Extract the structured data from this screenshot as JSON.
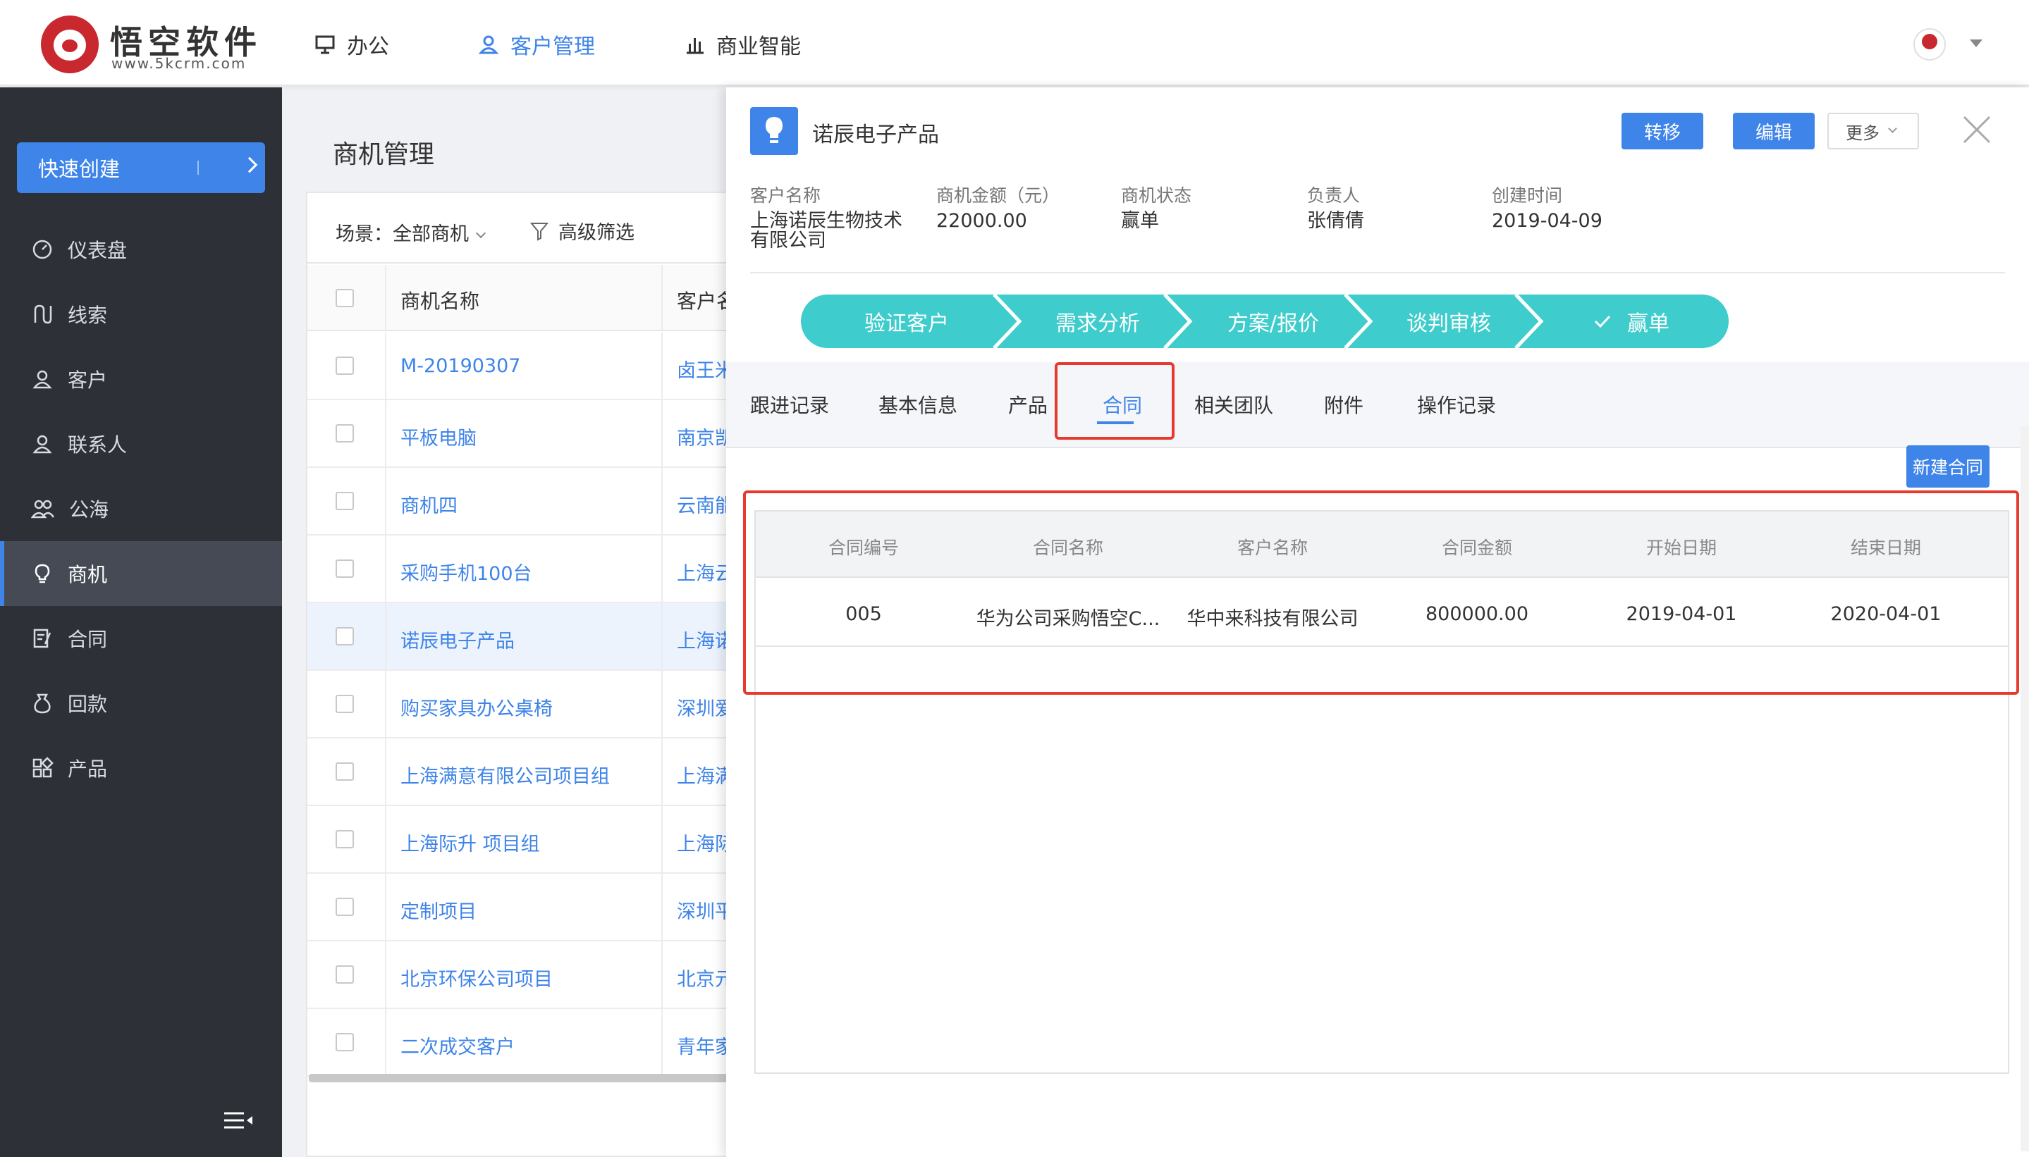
{
  "brand": {
    "name": "悟空软件",
    "url": "www.5kcrm.com"
  },
  "nav": [
    {
      "label": "办公",
      "icon": "monitor-icon",
      "active": false
    },
    {
      "label": "客户管理",
      "icon": "user-icon",
      "active": true
    },
    {
      "label": "商业智能",
      "icon": "bar-chart-icon",
      "active": false
    }
  ],
  "sidebar": {
    "quick_create": "快速创建",
    "items": [
      {
        "label": "仪表盘",
        "icon": "dashboard-icon"
      },
      {
        "label": "线索",
        "icon": "clue-icon"
      },
      {
        "label": "客户",
        "icon": "customer-icon"
      },
      {
        "label": "联系人",
        "icon": "contact-icon"
      },
      {
        "label": "公海",
        "icon": "pool-icon"
      },
      {
        "label": "商机",
        "icon": "bulb-icon",
        "active": true
      },
      {
        "label": "合同",
        "icon": "contract-icon"
      },
      {
        "label": "回款",
        "icon": "payment-icon"
      },
      {
        "label": "产品",
        "icon": "product-icon"
      }
    ]
  },
  "list": {
    "title": "商机管理",
    "scene": "场景：全部商机",
    "advanced_filter": "高级筛选",
    "columns": [
      "商机名称",
      "客户名称"
    ],
    "rows": [
      {
        "name": "M-20190307",
        "customer": "卤王米"
      },
      {
        "name": "平板电脑",
        "customer": "南京凯"
      },
      {
        "name": "商机四",
        "customer": "云南能"
      },
      {
        "name": "采购手机100台",
        "customer": "上海云"
      },
      {
        "name": "诺辰电子产品",
        "customer": "上海诺"
      },
      {
        "name": "购买家具办公桌椅",
        "customer": "深圳爱"
      },
      {
        "name": "上海满意有限公司项目组",
        "customer": "上海满"
      },
      {
        "name": "上海际升 项目组",
        "customer": "上海际"
      },
      {
        "name": "定制项目",
        "customer": "深圳平"
      },
      {
        "name": "北京环保公司项目",
        "customer": "北京元"
      },
      {
        "name": "二次成交客户",
        "customer": "青年家"
      }
    ]
  },
  "detail": {
    "title": "诺辰电子产品",
    "buttons": {
      "transfer": "转移",
      "edit": "编辑",
      "more": "更多"
    },
    "info": [
      {
        "label": "客户名称",
        "value": "上海诺辰生物技术有限公司"
      },
      {
        "label": "商机金额（元）",
        "value": "22000.00"
      },
      {
        "label": "商机状态",
        "value": "赢单"
      },
      {
        "label": "负责人",
        "value": "张倩倩"
      },
      {
        "label": "创建时间",
        "value": "2019-04-09"
      }
    ],
    "stages": [
      "验证客户",
      "需求分析",
      "方案/报价",
      "谈判审核",
      "赢单"
    ],
    "tabs": [
      "跟进记录",
      "基本信息",
      "产品",
      "合同",
      "相关团队",
      "附件",
      "操作记录"
    ],
    "active_tab": "合同",
    "new_contract": "新建合同",
    "contract_table": {
      "columns": [
        "合同编号",
        "合同名称",
        "客户名称",
        "合同金额",
        "开始日期",
        "结束日期"
      ],
      "rows": [
        [
          "005",
          "华为公司采购悟空C...",
          "华中来科技有限公司",
          "800000.00",
          "2019-04-01",
          "2020-04-01"
        ]
      ]
    }
  },
  "colors": {
    "accent": "#3e84e9",
    "stage": "#3ecccc",
    "sidebar_bg": "#2d3037",
    "highlight": "#e63a2e"
  }
}
